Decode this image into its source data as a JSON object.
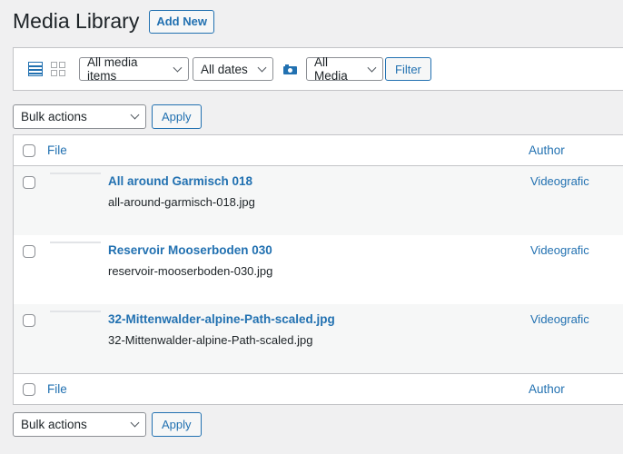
{
  "header": {
    "title": "Media Library",
    "add_new": "Add New"
  },
  "filters": {
    "view_modes": [
      "list-view",
      "grid-view"
    ],
    "media_type": "All media items",
    "dates": "All dates",
    "media_filter": "All Media",
    "filter_button": "Filter"
  },
  "bulk_top": {
    "select": "Bulk actions",
    "apply": "Apply"
  },
  "bulk_bottom": {
    "select": "Bulk actions",
    "apply": "Apply"
  },
  "table": {
    "columns": [
      "File",
      "Author"
    ],
    "rows": [
      {
        "title": "All around Garmisch 018",
        "filename": "all-around-garmisch-018.jpg",
        "author": "Videografic"
      },
      {
        "title": "Reservoir Mooserboden 030",
        "filename": "reservoir-mooserboden-030.jpg",
        "author": "Videografic"
      },
      {
        "title": "32-Mittenwalder-alpine-Path-scaled.jpg",
        "filename": "32-Mittenwalder-alpine-Path-scaled.jpg",
        "author": "Videografic"
      }
    ]
  },
  "colors": {
    "accent": "#2271b1",
    "background": "#f0f0f1",
    "border": "#c3c4c7"
  }
}
